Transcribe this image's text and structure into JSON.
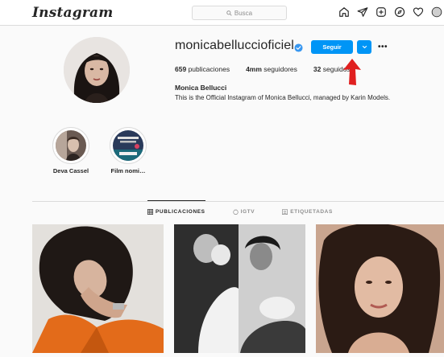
{
  "header": {
    "logo_text": "Instagram",
    "search_placeholder": "Busca",
    "nav_icons": [
      "home-icon",
      "direct-icon",
      "new-post-icon",
      "explore-icon",
      "activity-icon",
      "profile-avatar-icon"
    ]
  },
  "profile": {
    "username": "monicabelluccioficiel",
    "verified": true,
    "follow_label": "Seguir",
    "stats": {
      "posts_value": "659",
      "posts_label": "publicaciones",
      "followers_value": "4mm",
      "followers_label": "seguidores",
      "following_value": "32",
      "following_label": "seguidos"
    },
    "full_name": "Monica Bellucci",
    "bio": "This is the Official Instagram of Monica Bellucci, managed by Karin Models."
  },
  "highlights": [
    {
      "label": "Deva Cassel"
    },
    {
      "label": "Film nomi…"
    }
  ],
  "tabs": [
    {
      "label": "PUBLICACIONES",
      "active": true,
      "icon": "grid-icon"
    },
    {
      "label": "IGTV",
      "active": false,
      "icon": "igtv-icon"
    },
    {
      "label": "ETIQUETADAS",
      "active": false,
      "icon": "tagged-icon"
    }
  ],
  "colors": {
    "follow_blue": "#0095f6",
    "annotation_red": "#e02020",
    "border": "#dbdbdb",
    "background": "#fafafa"
  }
}
